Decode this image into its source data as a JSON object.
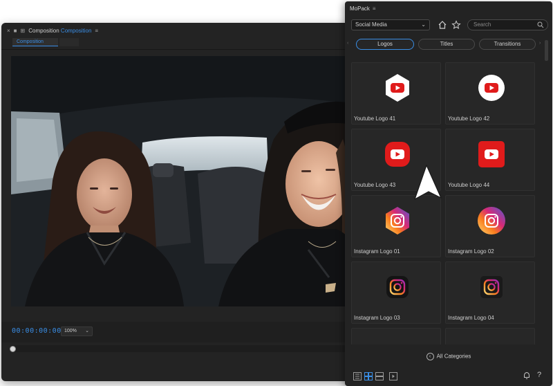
{
  "composition": {
    "title_prefix": "Composition",
    "title_accent": "Composition",
    "menu_icon": "≡",
    "subtab_label": "Composition",
    "timecode": "00:00:00:00",
    "zoom_value": "100%"
  },
  "mopack": {
    "title": "MoPack",
    "menu_icon": "≡",
    "category_value": "Social Media",
    "search_placeholder": "Search",
    "tabs": [
      {
        "label": "Logos",
        "active": true
      },
      {
        "label": "Titles",
        "active": false
      },
      {
        "label": "Transitions",
        "active": false
      }
    ],
    "tiles": [
      {
        "label": "Youtube Logo 41",
        "icon": "youtube-hexagon-icon"
      },
      {
        "label": "Youtube Logo 42",
        "icon": "youtube-circle-icon"
      },
      {
        "label": "Youtube Logo 43",
        "icon": "youtube-rounded-square-icon"
      },
      {
        "label": "Youtube Logo 44",
        "icon": "youtube-square-icon"
      },
      {
        "label": "Instagram Logo 01",
        "icon": "instagram-hexagon-icon"
      },
      {
        "label": "Instagram Logo 02",
        "icon": "instagram-circle-icon"
      },
      {
        "label": "Instagram Logo 03",
        "icon": "instagram-dark-icon"
      },
      {
        "label": "Instagram Logo 04",
        "icon": "instagram-dark-square-icon"
      }
    ],
    "all_categories": "All Categories"
  },
  "colors": {
    "accent": "#3a8ee6",
    "youtube_red": "#e01b1b",
    "panel_bg": "#232323"
  }
}
